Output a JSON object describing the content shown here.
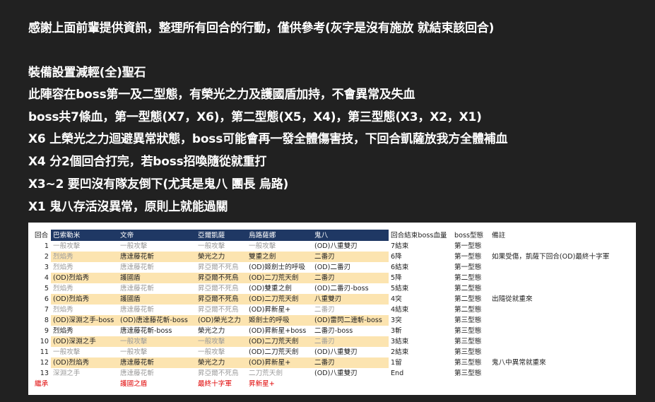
{
  "post": {
    "lines": [
      "感謝上面前輩提供資訊，整理所有回合的行動，僅供參考(灰字是沒有施放 就結束該回合)",
      "",
      "裝備設置減輕(全)聖石",
      "此陣容在boss第一及二型態，有榮光之力及護國盾加持，不會異常及失血",
      "boss共7條血，第一型態(X7，X6)，第二型態(X5，X4)，第三型態(X3，X2，X1)",
      "X6 上榮光之力迴避異常狀態，boss可能會再一發全體傷害技，下回合凱薩放我方全體補血",
      "X4 分2個回合打完，若boss招喚隨從就重打",
      "X3~2 要凹沒有隊友倒下(尤其是鬼八 團長 烏路)",
      "X1 鬼八存活沒異常，原則上就能過關"
    ]
  },
  "table": {
    "headers": [
      "回合",
      "巴索勒米",
      "文帝",
      "亞爾凱薩",
      "烏路薩娜",
      "鬼八",
      "回合結束boss血量",
      "boss型態",
      "備註"
    ],
    "rows": [
      {
        "n": "1",
        "c": [
          {
            "t": "一般攻擊",
            "g": true
          },
          {
            "t": "一般攻擊",
            "g": true
          },
          {
            "t": "一般攻擊",
            "g": true
          },
          {
            "t": "一般攻擊",
            "g": true
          },
          {
            "t": "(OD)八重雙刃",
            "g": false
          }
        ],
        "hp": "7結束",
        "form": "第一型態",
        "note": ""
      },
      {
        "n": "2",
        "c": [
          {
            "t": "烈焰秀",
            "g": true
          },
          {
            "t": "唐達藤花斬",
            "g": false
          },
          {
            "t": "榮光之力",
            "g": false
          },
          {
            "t": "雙重之劍",
            "g": false
          },
          {
            "t": "二番刃",
            "g": false
          }
        ],
        "hp": "6降",
        "form": "第一型態",
        "note": "如果受傷，凱薩下回合(OD)最終十字軍"
      },
      {
        "n": "3",
        "c": [
          {
            "t": "烈焰秀",
            "g": true
          },
          {
            "t": "唐達藤花斬",
            "g": true
          },
          {
            "t": "昇亞爾不死鳥",
            "g": true
          },
          {
            "t": "(OD)姬劍士的呼吸",
            "g": false
          },
          {
            "t": "(OD)二番刃",
            "g": false
          }
        ],
        "hp": "6結束",
        "form": "第一型態",
        "note": ""
      },
      {
        "n": "4",
        "c": [
          {
            "t": "(OD)烈焰秀",
            "g": false
          },
          {
            "t": "護國盾",
            "g": false
          },
          {
            "t": "昇亞爾不死鳥",
            "g": false
          },
          {
            "t": "(OD)二刀荒天劍",
            "g": false
          },
          {
            "t": "二番刃",
            "g": false
          }
        ],
        "hp": "5降",
        "form": "第二型態",
        "note": ""
      },
      {
        "n": "5",
        "c": [
          {
            "t": "烈焰秀",
            "g": true
          },
          {
            "t": "唐達藤花斬",
            "g": true
          },
          {
            "t": "昇亞爾不死鳥",
            "g": true
          },
          {
            "t": "(OD)雙重之劍",
            "g": false
          },
          {
            "t": "(OD)二番刃-boss",
            "g": false
          }
        ],
        "hp": "5結束",
        "form": "第二型態",
        "note": ""
      },
      {
        "n": "6",
        "c": [
          {
            "t": "(OD)烈焰秀",
            "g": false
          },
          {
            "t": "護國盾",
            "g": false
          },
          {
            "t": "昇亞爾不死鳥",
            "g": false
          },
          {
            "t": "(OD)二刀荒天劍",
            "g": false
          },
          {
            "t": "八重雙刃",
            "g": false
          }
        ],
        "hp": "4突",
        "form": "第二型態",
        "note": "出隨從就重來"
      },
      {
        "n": "7",
        "c": [
          {
            "t": "烈焰秀",
            "g": true
          },
          {
            "t": "唐達藤花斬",
            "g": true
          },
          {
            "t": "昇亞爾不死鳥",
            "g": true
          },
          {
            "t": "(OD)昇新星+",
            "g": false
          },
          {
            "t": "二番刃",
            "g": true
          }
        ],
        "hp": "4結束",
        "form": "第二型態",
        "note": ""
      },
      {
        "n": "8",
        "c": [
          {
            "t": "(OD)深淵之手-boss",
            "g": false
          },
          {
            "t": "(OD)唐達藤花斬-boss",
            "g": false
          },
          {
            "t": "(OD)榮光之力",
            "g": false
          },
          {
            "t": "姬劍士的呼吸",
            "g": false
          },
          {
            "t": "(OD)雷閃二連斬-boss",
            "g": false
          }
        ],
        "hp": "3突",
        "form": "第三型態",
        "note": ""
      },
      {
        "n": "9",
        "c": [
          {
            "t": "烈焰秀",
            "g": false
          },
          {
            "t": "唐達藤花斬-boss",
            "g": false
          },
          {
            "t": "榮光之力",
            "g": false
          },
          {
            "t": "(OD)昇新星+boss",
            "g": false
          },
          {
            "t": "二番刃-boss",
            "g": false
          }
        ],
        "hp": "3斬",
        "form": "第三型態",
        "note": ""
      },
      {
        "n": "10",
        "c": [
          {
            "t": "(OD)深淵之手",
            "g": false
          },
          {
            "t": "一般攻擊",
            "g": true
          },
          {
            "t": "一般攻擊",
            "g": true
          },
          {
            "t": "(OD)二刀荒天劍",
            "g": false
          },
          {
            "t": "二番刃",
            "g": true
          }
        ],
        "hp": "3結束",
        "form": "第三型態",
        "note": ""
      },
      {
        "n": "11",
        "c": [
          {
            "t": "一般攻擊",
            "g": true
          },
          {
            "t": "一般攻擊",
            "g": true
          },
          {
            "t": "一般攻擊",
            "g": true
          },
          {
            "t": "(OD)二刀荒天劍",
            "g": false
          },
          {
            "t": "(OD)八重雙刃",
            "g": false
          }
        ],
        "hp": "2結束",
        "form": "第三型態",
        "note": ""
      },
      {
        "n": "12",
        "c": [
          {
            "t": "(OD)烈焰秀",
            "g": false
          },
          {
            "t": "唐達藤花斬",
            "g": false
          },
          {
            "t": "榮光之力",
            "g": false
          },
          {
            "t": "(OD)昇新星+",
            "g": false
          },
          {
            "t": "二番刃",
            "g": false
          }
        ],
        "hp": "1留",
        "form": "第三型態",
        "note": "鬼八中異常就重來"
      },
      {
        "n": "13",
        "c": [
          {
            "t": "深淵之手",
            "g": true
          },
          {
            "t": "唐達藤花斬",
            "g": true
          },
          {
            "t": "昇亞爾不死鳥",
            "g": true
          },
          {
            "t": "二刀荒天劍",
            "g": true
          },
          {
            "t": "(OD)八重雙刃",
            "g": false
          }
        ],
        "hp": "End",
        "form": "第三型態",
        "note": ""
      }
    ],
    "footer": {
      "label": "繼承",
      "c": [
        "",
        "護國之盾",
        "最終十字軍",
        "昇新星+",
        ""
      ]
    }
  },
  "colors": {
    "background": "#212121",
    "header_blue": "#1f3864",
    "row_highlight": "#fce4b0",
    "gray_text": "#9a9a9a",
    "red_text": "#e00000"
  }
}
